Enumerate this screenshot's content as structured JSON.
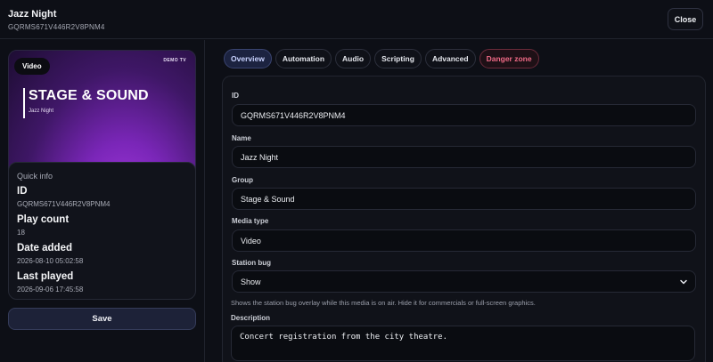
{
  "header": {
    "title": "Jazz Night",
    "subtitle": "GQRMS671V446R2V8PNM4",
    "close_label": "Close"
  },
  "thumbnail": {
    "badge": "Video",
    "channel": "DEMO TV",
    "title": "STAGE & SOUND",
    "subtitle": "Jazz Night"
  },
  "quick_info": {
    "heading": "Quick info",
    "items": [
      {
        "label": "ID",
        "value": "GQRMS671V446R2V8PNM4"
      },
      {
        "label": "Play count",
        "value": "18"
      },
      {
        "label": "Date added",
        "value": "2026-08-10 05:02:58"
      },
      {
        "label": "Last played",
        "value": "2026-09-06 17:45:58"
      }
    ]
  },
  "save_label": "Save",
  "tabs": [
    {
      "label": "Overview",
      "active": true
    },
    {
      "label": "Automation"
    },
    {
      "label": "Audio"
    },
    {
      "label": "Scripting"
    },
    {
      "label": "Advanced"
    },
    {
      "label": "Danger zone",
      "danger": true
    }
  ],
  "form": {
    "id": {
      "label": "ID",
      "value": "GQRMS671V446R2V8PNM4"
    },
    "name": {
      "label": "Name",
      "value": "Jazz Night"
    },
    "group": {
      "label": "Group",
      "value": "Stage & Sound"
    },
    "media_type": {
      "label": "Media type",
      "value": "Video"
    },
    "station_bug": {
      "label": "Station bug",
      "value": "Show",
      "hint": "Shows the station bug overlay while this media is on air. Hide it for commercials or full-screen graphics."
    },
    "description": {
      "label": "Description",
      "value": "Concert registration from the city theatre."
    }
  },
  "colors": {
    "background": "#0d0f16",
    "accent": "#c9d3ff",
    "danger": "#f06a86",
    "thumbnail_purple": "#a63adf"
  },
  "icons": {
    "select_chevron": "chevron-down-icon"
  }
}
